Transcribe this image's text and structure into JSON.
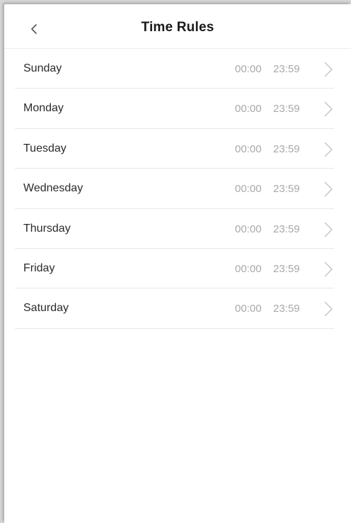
{
  "header": {
    "title": "Time Rules",
    "back_icon": "chevron-left-icon"
  },
  "rules": [
    {
      "day": "Sunday",
      "start": "00:00",
      "end": "23:59"
    },
    {
      "day": "Monday",
      "start": "00:00",
      "end": "23:59"
    },
    {
      "day": "Tuesday",
      "start": "00:00",
      "end": "23:59"
    },
    {
      "day": "Wednesday",
      "start": "00:00",
      "end": "23:59"
    },
    {
      "day": "Thursday",
      "start": "00:00",
      "end": "23:59"
    },
    {
      "day": "Friday",
      "start": "00:00",
      "end": "23:59"
    },
    {
      "day": "Saturday",
      "start": "00:00",
      "end": "23:59"
    }
  ],
  "row_icon": "chevron-right-icon",
  "colors": {
    "background": "#ffffff",
    "text": "#2b2b2b",
    "time_text": "#a9a9a9",
    "divider": "#e8e8e8"
  }
}
